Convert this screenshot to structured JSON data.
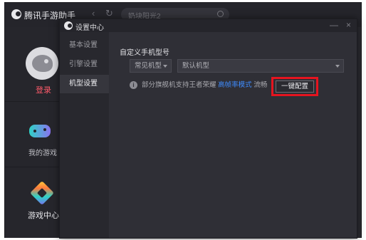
{
  "app": {
    "title": "腾讯手游助手",
    "search_placeholder": "奶块阳光2"
  },
  "sidebar": {
    "login_label": "登录",
    "my_games_label": "我的游戏",
    "game_center_label": "游戏中心"
  },
  "dialog": {
    "title": "设置中心",
    "nav": [
      {
        "label": "基本设置"
      },
      {
        "label": "引擎设置"
      },
      {
        "label": "机型设置",
        "active": true
      }
    ],
    "section_title": "自定义手机型号",
    "select_category": "常见机型",
    "select_model": "默认机型",
    "info_text_before": "部分旗舰机支持王者荣耀",
    "info_link": "高帧率模式",
    "info_text_after": "流畅",
    "config_button": "一键配置"
  },
  "colors": {
    "accent_login": "#ff5a6a",
    "link": "#3f8cff",
    "highlight": "#e5141f"
  }
}
